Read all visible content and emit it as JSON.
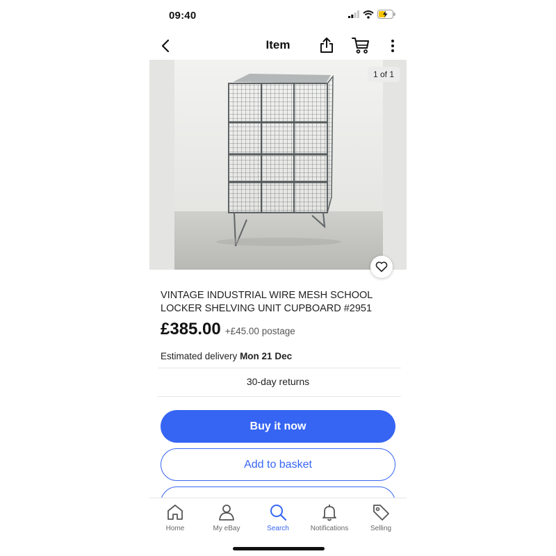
{
  "status_bar": {
    "time": "09:40"
  },
  "nav": {
    "title": "Item"
  },
  "image": {
    "counter": "1 of 1"
  },
  "item": {
    "title": "VINTAGE INDUSTRIAL WIRE MESH SCHOOL LOCKER SHELVING UNIT CUPBOARD #2951",
    "price": "£385.00",
    "postage": "+£45.00 postage",
    "delivery_label": "Estimated delivery",
    "delivery_date": "Mon 21 Dec",
    "returns": "30-day returns"
  },
  "actions": {
    "buy_now": "Buy it now",
    "add_to_basket": "Add to basket"
  },
  "tab_bar": {
    "items": [
      {
        "label": "Home",
        "icon": "home-icon"
      },
      {
        "label": "My eBay",
        "icon": "person-icon"
      },
      {
        "label": "Search",
        "icon": "search-icon",
        "active": true
      },
      {
        "label": "Notifications",
        "icon": "bell-icon"
      },
      {
        "label": "Selling",
        "icon": "tag-icon"
      }
    ]
  },
  "colors": {
    "accent": "#3665f3",
    "image_bg": "#e4e4e2"
  }
}
